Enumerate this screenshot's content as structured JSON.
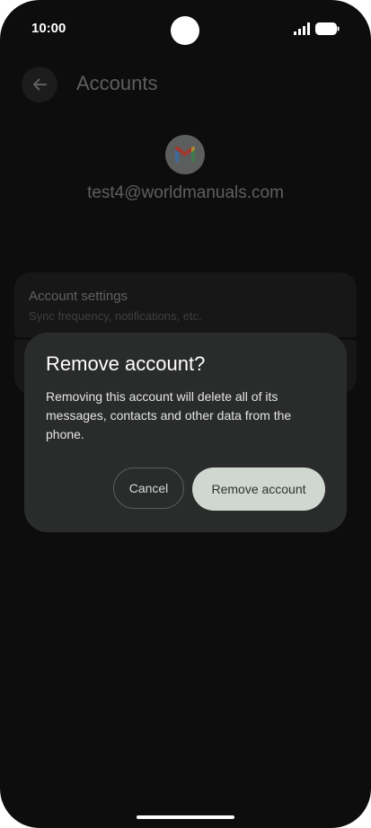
{
  "status_bar": {
    "time": "10:00",
    "icons": [
      "signal-icon",
      "battery-icon"
    ]
  },
  "header": {
    "title": "Accounts",
    "back_icon": "arrow-left-icon"
  },
  "account": {
    "icon": "gmail-logo-icon",
    "email": "test4@worldmanuals.com"
  },
  "settings": {
    "items": [
      {
        "title": "Account settings",
        "subtitle": "Sync frequency, notifications, etc."
      }
    ]
  },
  "dialog": {
    "title": "Remove account?",
    "message": "Removing this account will delete all of its messages, contacts and other data from the phone.",
    "cancel_label": "Cancel",
    "confirm_label": "Remove account"
  },
  "colors": {
    "background": "#0d0d0d",
    "dialog_surface": "#2a2c2b",
    "confirm_button": "#cfd7d0"
  }
}
